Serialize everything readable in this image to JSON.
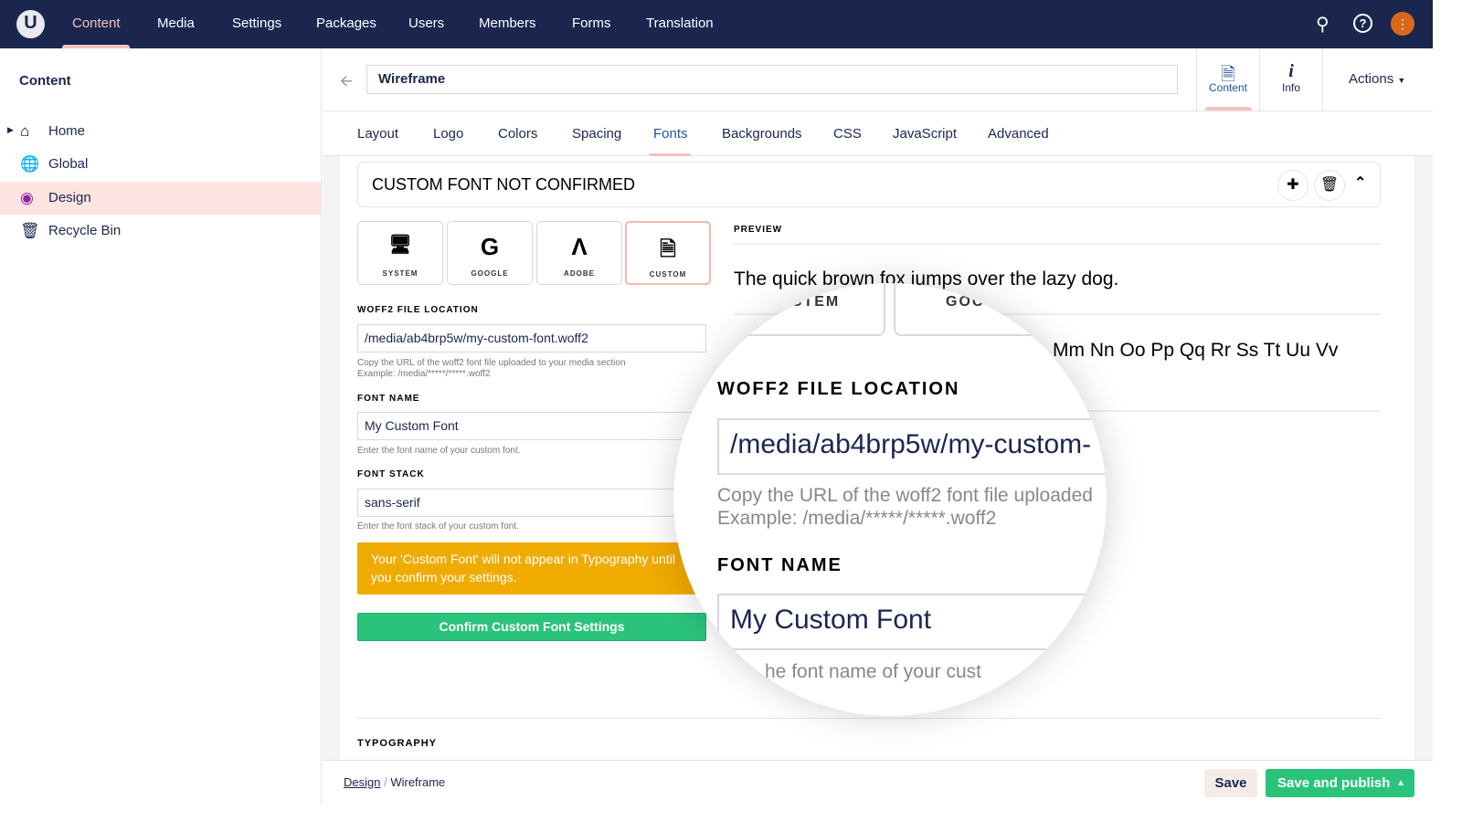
{
  "topnav": {
    "items": [
      "Content",
      "Media",
      "Settings",
      "Packages",
      "Users",
      "Members",
      "Forms",
      "Translation"
    ],
    "active": "Content",
    "logo": "U"
  },
  "sidebar": {
    "title": "Content",
    "items": [
      {
        "label": "Home",
        "icon": "home-icon"
      },
      {
        "label": "Global",
        "icon": "globe-icon"
      },
      {
        "label": "Design",
        "icon": "paint-icon"
      },
      {
        "label": "Recycle Bin",
        "icon": "trash-icon"
      }
    ],
    "selected": "Design"
  },
  "header": {
    "name": "Wireframe",
    "apps": [
      {
        "label": "Content"
      },
      {
        "label": "Info"
      }
    ],
    "actions": "Actions"
  },
  "tabs": [
    "Layout",
    "Logo",
    "Colors",
    "Spacing",
    "Fonts",
    "Backgrounds",
    "CSS",
    "JavaScript",
    "Advanced"
  ],
  "block": {
    "title": "CUSTOM FONT NOT CONFIRMED"
  },
  "sources": [
    {
      "label": "SYSTEM"
    },
    {
      "label": "GOOGLE"
    },
    {
      "label": "ADOBE"
    },
    {
      "label": "CUSTOM"
    }
  ],
  "form": {
    "woff2_label": "WOFF2 FILE LOCATION",
    "woff2_value": "/media/ab4brp5w/my-custom-font.woff2",
    "woff2_help1": "Copy the URL of the woff2 font file uploaded to your media section",
    "woff2_help2": "Example: /media/*****/*****.woff2",
    "name_label": "FONT NAME",
    "name_value": "My Custom Font",
    "name_help": "Enter the font name of your custom font.",
    "stack_label": "FONT STACK",
    "stack_value": "sans-serif",
    "stack_help": "Enter the font stack of your custom font.",
    "warning": "Your 'Custom Font' will not appear in Typography until you confirm your settings.",
    "confirm": "Confirm Custom Font Settings"
  },
  "preview": {
    "label": "PREVIEW",
    "text": "The quick brown fox jumps over the lazy dog.",
    "alphabet": "Mm Nn Oo Pp Qq Rr Ss Tt Uu Vv"
  },
  "magnifier": {
    "box1": "STEM",
    "box2": "GOOG",
    "woff2_value": "/media/ab4brp5w/my-custom-",
    "woff2_help1": "Copy the URL of the woff2 font file uploaded",
    "name_help": "he font name of your cust"
  },
  "typography": "TYPOGRAPHY",
  "footer": {
    "crumb1": "Design",
    "sep": "/",
    "crumb2": "Wireframe",
    "save": "Save",
    "publish": "Save and publish"
  }
}
